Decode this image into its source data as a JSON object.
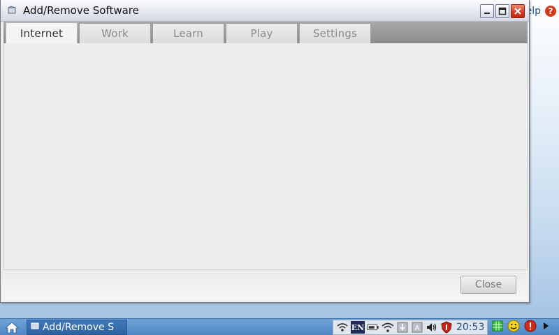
{
  "desktop": {
    "help_fragment": "elp"
  },
  "window": {
    "title": "Add/Remove Software",
    "tabs": [
      {
        "label": "Internet",
        "active": true
      },
      {
        "label": "Work",
        "active": false
      },
      {
        "label": "Learn",
        "active": false
      },
      {
        "label": "Play",
        "active": false
      },
      {
        "label": "Settings",
        "active": false
      }
    ],
    "close_label": "Close"
  },
  "taskbar": {
    "task_label": "Add/Remove S",
    "lang": "EN",
    "clock": "20:53"
  },
  "icons": {
    "app": "package-icon",
    "minimize": "minimize-icon",
    "maximize": "maximize-icon",
    "close": "close-icon",
    "home": "home-icon"
  },
  "colors": {
    "taskbar": "#4f87c4",
    "close_button": "#d4391f",
    "help": "#d43a1a"
  }
}
